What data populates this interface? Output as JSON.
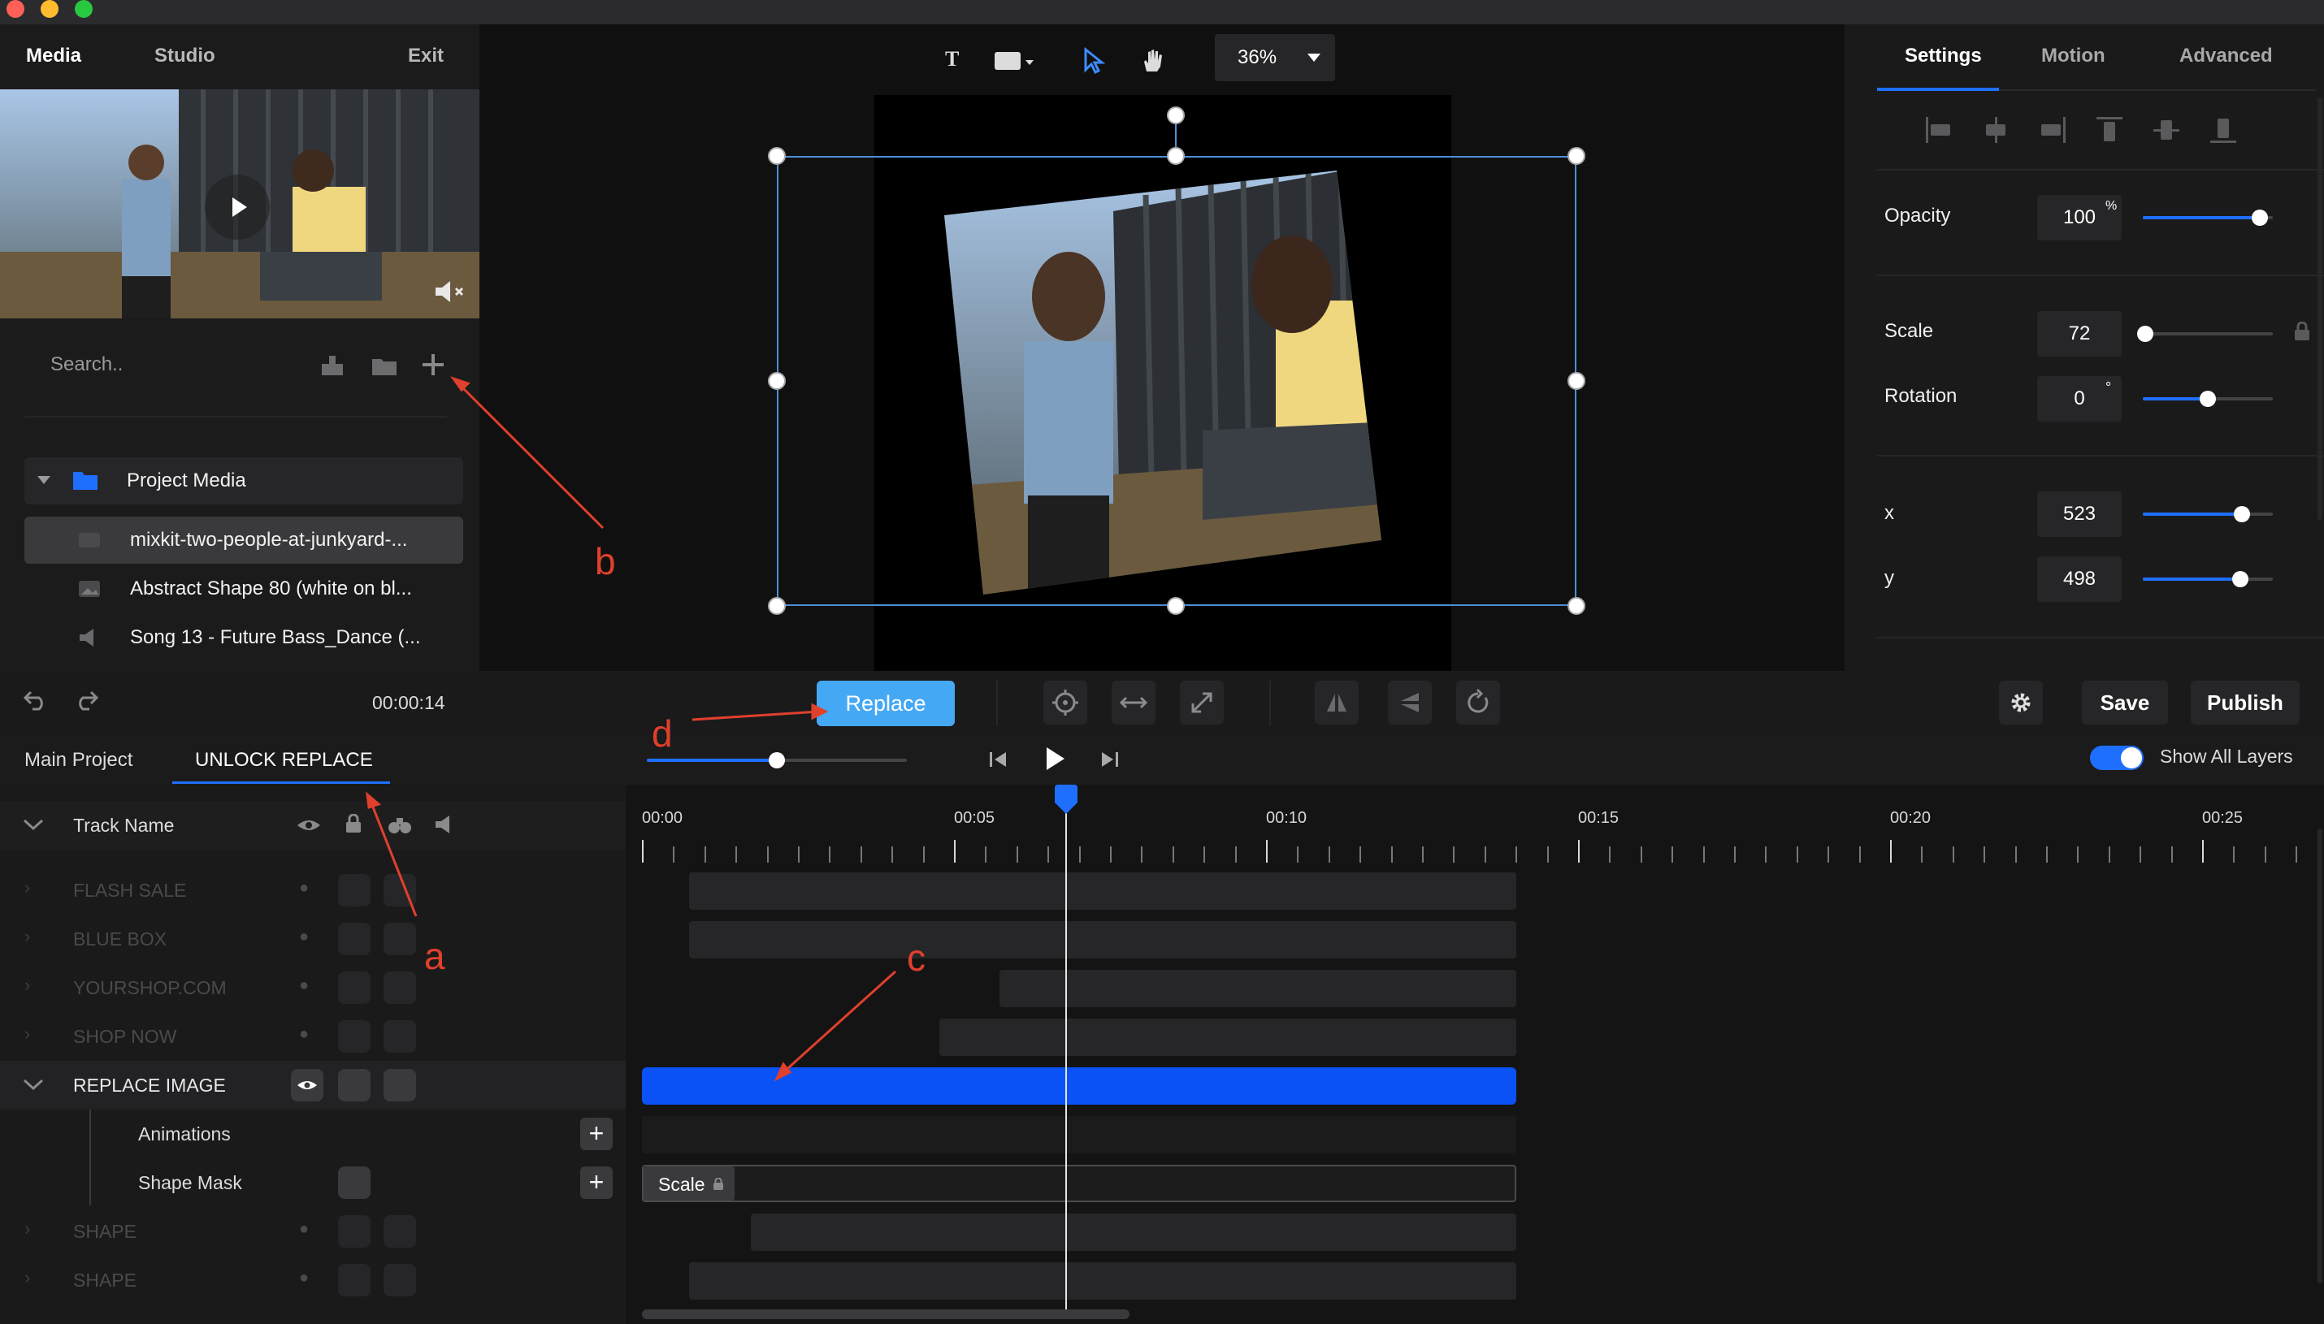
{
  "window": {
    "controls": [
      "close",
      "minimize",
      "maximize"
    ]
  },
  "left_panel": {
    "tabs": [
      "Media",
      "Studio"
    ],
    "exit_label": "Exit",
    "search_placeholder": "Search..",
    "folder_label": "Project Media",
    "media_items": [
      {
        "label": "mixkit-two-people-at-junkyard-...",
        "icon": "video-icon"
      },
      {
        "label": "Abstract Shape 80 (white on bl...",
        "icon": "image-icon"
      },
      {
        "label": "Song 13 - Future Bass_Dance (...",
        "icon": "audio-icon"
      }
    ],
    "timecode": "00:00:14"
  },
  "canvas_toolbar": {
    "zoom": "36%"
  },
  "inspector": {
    "tabs": [
      "Settings",
      "Motion",
      "Advanced"
    ],
    "opacity_label": "Opacity",
    "opacity_value": "100",
    "opacity_unit": "%",
    "opacity_level": 0.9,
    "scale_label": "Scale",
    "scale_value": "72",
    "scale_level": 0.02,
    "rotation_label": "Rotation",
    "rotation_value": "0",
    "rotation_unit": "°",
    "rotation_level": 0.5,
    "x_label": "x",
    "x_value": "523",
    "x_level": 0.76,
    "y_label": "y",
    "y_value": "498",
    "y_level": 0.75
  },
  "toolbar": {
    "replace_label": "Replace",
    "save_label": "Save",
    "publish_label": "Publish"
  },
  "timeline": {
    "tabs": [
      "Main Project",
      "UNLOCK REPLACE"
    ],
    "show_all_layers_label": "Show All Layers",
    "track_header": "Track Name",
    "time_labels": [
      "00:00",
      "00:05",
      "00:10",
      "00:15",
      "00:20",
      "00:25"
    ],
    "tracks": [
      "FLASH SALE",
      "BLUE BOX",
      "YOURSHOP.COM",
      "SHOP NOW",
      "REPLACE IMAGE",
      "Animations",
      "Shape Mask",
      "SHAPE",
      "SHAPE"
    ],
    "scale_clip_label": "Scale"
  },
  "annotations": [
    "a",
    "b",
    "c",
    "d"
  ],
  "colors": {
    "accent": "#1f6fff",
    "replace_button": "#45a8f5",
    "annotation": "#e0402c"
  }
}
